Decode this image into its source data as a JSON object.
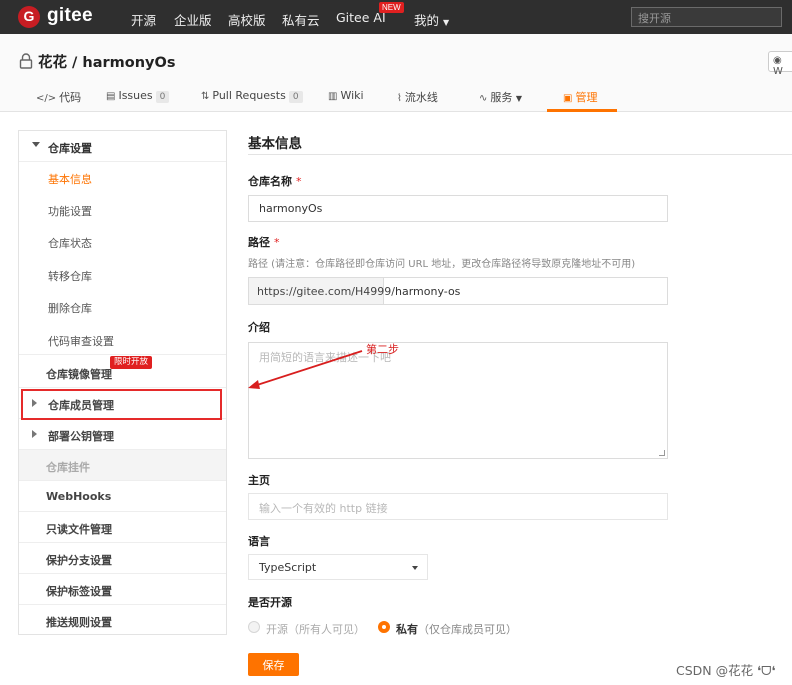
{
  "nav": {
    "logo_letter": "G",
    "brand": "gitee",
    "links": [
      "开源",
      "企业版",
      "高校版",
      "私有云",
      "Gitee AI",
      "我的"
    ],
    "new_badge": "NEW",
    "search_placeholder": "搜开源"
  },
  "repo": {
    "title": "花花 / harmonyOs",
    "watch_label": "W",
    "tabs": [
      {
        "icon": "</>",
        "label": "代码"
      },
      {
        "icon": "▤",
        "label": "Issues",
        "count": "0"
      },
      {
        "icon": "⇅",
        "label": "Pull Requests",
        "count": "0"
      },
      {
        "icon": "▥",
        "label": "Wiki"
      },
      {
        "icon": "⌇",
        "label": "流水线"
      },
      {
        "icon": "∿",
        "label": "服务"
      },
      {
        "icon": "▣",
        "label": "管理"
      }
    ],
    "active_tab": "管理"
  },
  "sidebar": {
    "section": "仓库设置",
    "items": [
      "基本信息",
      "功能设置",
      "仓库状态",
      "转移仓库",
      "删除仓库",
      "代码审查设置"
    ],
    "mirror": "仓库镜像管理",
    "limited_badge": "限时开放",
    "members": "仓库成员管理",
    "deploy_keys": "部署公钥管理",
    "widgets": "仓库挂件",
    "webhooks": "WebHooks",
    "readonly": "只读文件管理",
    "branch_protect": "保护分支设置",
    "tag_protect": "保护标签设置",
    "push_rules": "推送规则设置"
  },
  "form": {
    "section_title": "基本信息",
    "name_label": "仓库名称",
    "name_value": "harmonyOs",
    "path_label": "路径",
    "path_hint": "路径 (请注意：仓库路径即仓库访问 URL 地址，更改仓库路径将导致原克隆地址不可用)",
    "path_prefix": "https://gitee.com/H4999/",
    "path_value": "harmony-os",
    "intro_label": "介绍",
    "intro_placeholder": "用简短的语言来描述一下吧",
    "homepage_label": "主页",
    "homepage_placeholder": "输入一个有效的 http 链接",
    "lang_label": "语言",
    "lang_value": "TypeScript",
    "open_label": "是否开源",
    "public_label": "开源",
    "public_note": "（所有人可见）",
    "private_label": "私有",
    "private_note": "（仅仓库成员可见）",
    "selected_visibility": "私有",
    "save": "保存",
    "required_mark": "*"
  },
  "annotation": "第二步",
  "watermark": "CSDN @花花 ❛ᗜ❛",
  "colors": {
    "accent": "#fe7300",
    "nav_bg": "#2f2f2f",
    "logo": "#c71d23",
    "annot_red": "#d81e1e"
  }
}
